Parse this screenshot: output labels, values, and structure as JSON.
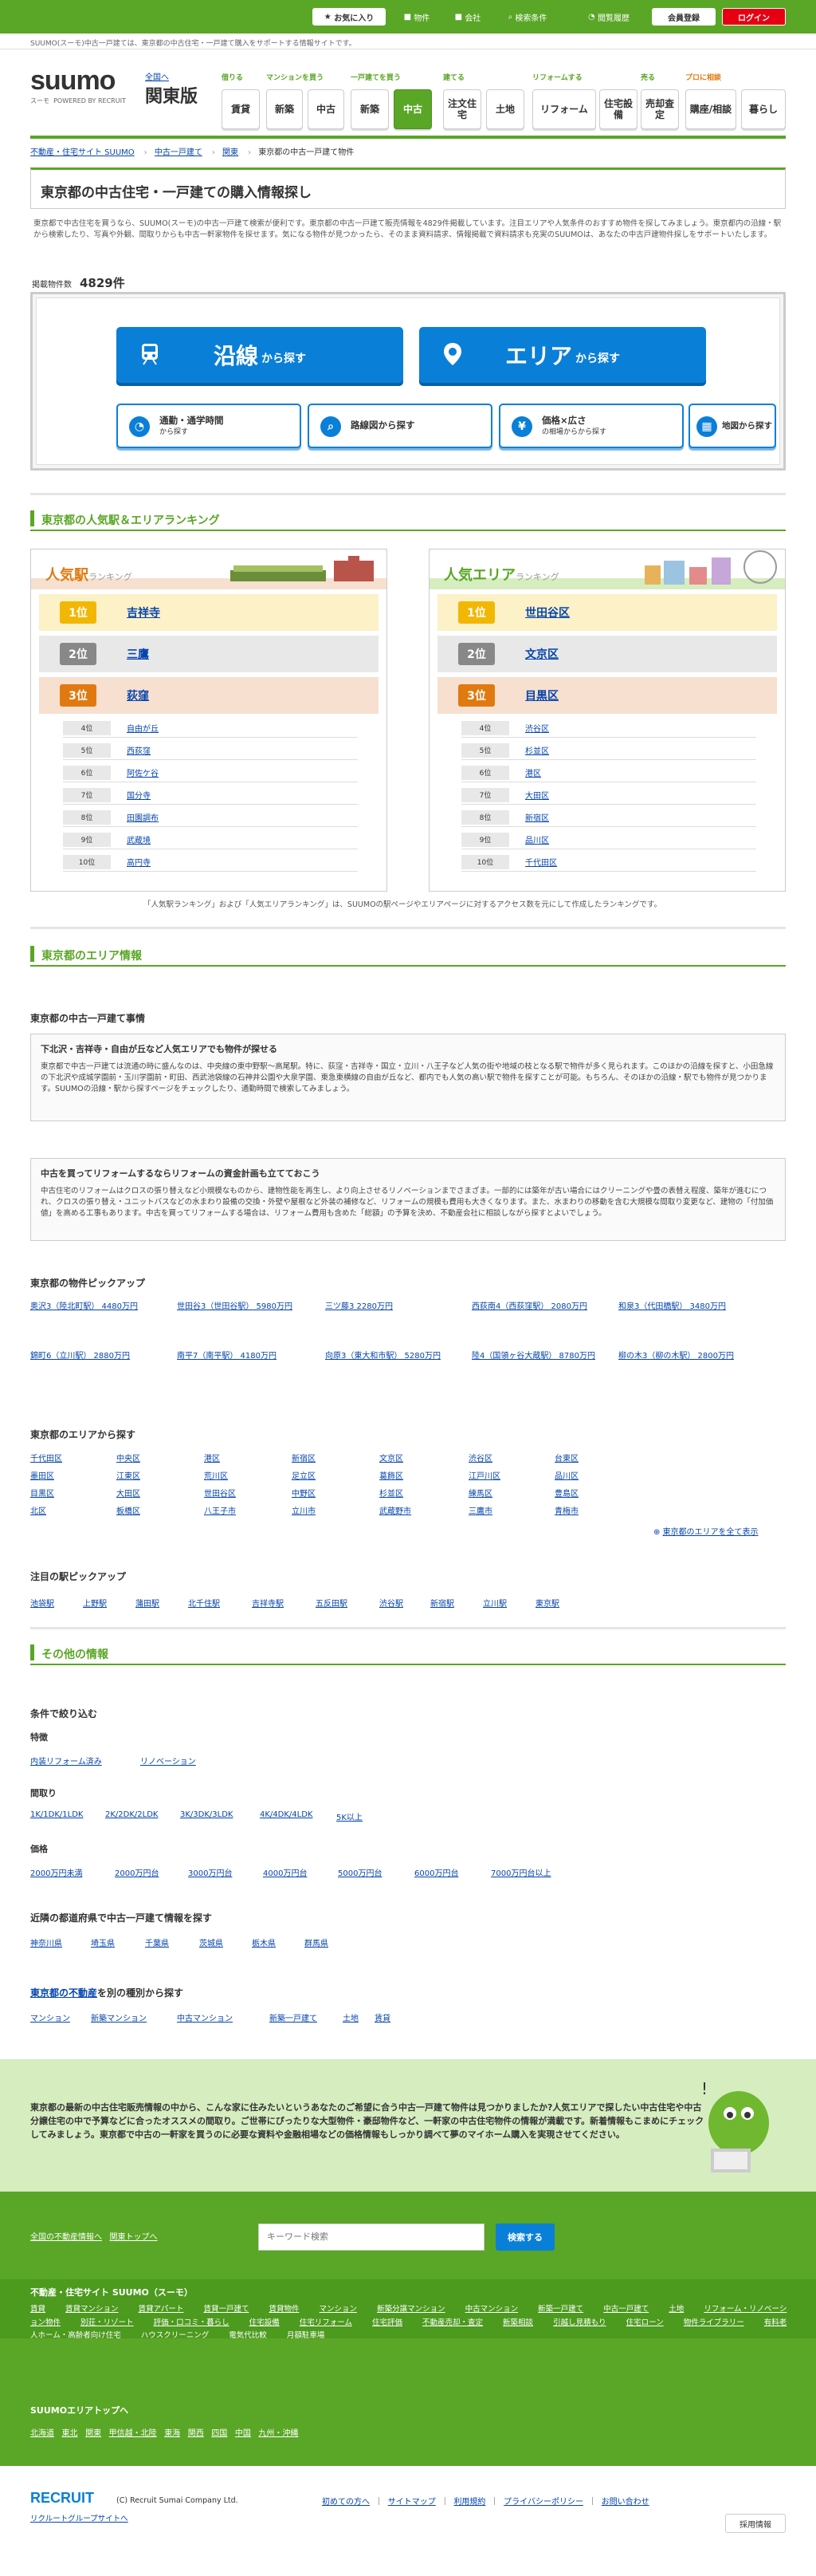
{
  "topbar": {
    "favorites": "お気に入り",
    "property": "物件",
    "company": "会社",
    "articles": "検索条件",
    "history": "閲覧履歴",
    "register": "会員登録",
    "login": "ログイン"
  },
  "header": {
    "tagline": "SUUMO(スーモ)中古一戸建ては、東京都の中古住宅・一戸建て購入をサポートする情報サイトです。",
    "logo": "suumo",
    "logo_sub": "スーモ",
    "logo_powered": "POWERED BY RECRUIT",
    "all_regions": "全国へ",
    "region": "関東版"
  },
  "nav": {
    "groups": [
      "借りる",
      "マンションを買う",
      "一戸建てを買う",
      "建てる",
      "リフォームする",
      "売る",
      "プロに相談"
    ],
    "buttons": [
      "賃貸",
      "新築",
      "中古",
      "新築",
      "中古",
      "注文住宅",
      "土地",
      "リフォーム",
      "住宅設備",
      "売却査定",
      "購座/相談",
      "暮らし"
    ]
  },
  "breadcrumb": [
    "不動産・住宅サイト SUUMO",
    "中古一戸建て",
    "関東",
    "東京都の中古一戸建て物件"
  ],
  "page_title": "東京都の中古住宅・一戸建ての購入情報探し",
  "intro": "東京都で中古住宅を買うなら、SUUMO(スーモ)の中古一戸建て検索が便利です。東京都の中古一戸建て販売情報を4829件掲載しています。注目エリアや人気条件のおすすめ物件を探してみましょう。東京都内の沿線・駅から検索したり、写真や外観、間取りからも中古一軒家物件を探せます。気になる物件が見つかったら、そのまま資料請求、情報掲載で資料請求も充実のSUUMOは、あなたの中古戸建物件探しをサポートいたします。",
  "count": {
    "label": "掲載物件数",
    "value": "4829件"
  },
  "search": {
    "line": {
      "big": "沿線",
      "small": "から探す"
    },
    "area": {
      "big": "エリア",
      "small": "から探す"
    },
    "commute": {
      "label": "通勤・通学時間",
      "sub": "から探す"
    },
    "route": {
      "label": "路線図から探す"
    },
    "price": {
      "label": "価格×広さ",
      "sub": "の相場からから探す"
    },
    "map": {
      "label": "地図から探す"
    }
  },
  "ranking": {
    "header": "東京都の人気駅＆エリアランキング",
    "station": {
      "title": "人気駅",
      "title_sub": "ランキング",
      "top": [
        "吉祥寺",
        "三鷹",
        "荻窪"
      ],
      "rest": [
        {
          "rank": "4位",
          "name": "自由が丘"
        },
        {
          "rank": "5位",
          "name": "西荻窪"
        },
        {
          "rank": "6位",
          "name": "阿佐ケ谷"
        },
        {
          "rank": "7位",
          "name": "国分寺"
        },
        {
          "rank": "8位",
          "name": "田園調布"
        },
        {
          "rank": "9位",
          "name": "武蔵境"
        },
        {
          "rank": "10位",
          "name": "高円寺"
        }
      ]
    },
    "area": {
      "title": "人気エリア",
      "title_sub": "ランキング",
      "top": [
        "世田谷区",
        "文京区",
        "目黒区"
      ],
      "rest": [
        {
          "rank": "4位",
          "name": "渋谷区"
        },
        {
          "rank": "5位",
          "name": "杉並区"
        },
        {
          "rank": "6位",
          "name": "港区"
        },
        {
          "rank": "7位",
          "name": "大田区"
        },
        {
          "rank": "8位",
          "name": "新宿区"
        },
        {
          "rank": "9位",
          "name": "品川区"
        },
        {
          "rank": "10位",
          "name": "千代田区"
        }
      ]
    },
    "medals": [
      "1位",
      "2位",
      "3位"
    ],
    "note": "「人気駅ランキング」および「人気エリアランキング」は、SUUMOの駅ページやエリアページに対するアクセス数を元にして作成したランキングです。"
  },
  "areainfo": {
    "header": "東京都のエリア情報",
    "subtitle": "東京都の中古一戸建て事情",
    "box1_title": "下北沢・吉祥寺・自由が丘など人気エリアでも物件が探せる",
    "box1_text": "東京都で中古一戸建ては流通の時に盛んなのは、中央線の東中野駅〜高尾駅。特に、荻窪・吉祥寺・国立・立川・八王子など人気の街や地域の枝となる駅で物件が多く見られます。このほかの沿線を探すと、小田急線の下北沢や成城学園前・玉川学園前・町田、西武池袋線の石神井公園や大泉学園、東急東横線の自由が丘など、都内でも人気の高い駅で物件を探すことが可能。もちろん、そのほかの沿線・駅でも物件が見つかります。SUUMOの沿線・駅から探すページをチェックしたり、通勤時間で検索してみましょう。",
    "box2_title": "中古を買ってリフォームするならリフォームの資金計画も立てておこう",
    "box2_text": "中古住宅のリフォームはクロスの張り替えなど小規模なものから、建物性能を再生し、より向上させるリノベーションまでさまざま。一部的には築年が古い場合にはクリーニングや畳の表替え程度、築年が進むにつれ、クロスの張り替え・ユニットバスなどの水まわり設備の交換・外壁や屋根など外装の補修など、リフォームの規模も費用も大きくなります。また、水まわりの移動を含む大規模な間取り変更など、建物の「付加価値」を高める工事もあります。中古を買ってリフォームする場合は、リフォーム費用も含めた「総額」の予算を決め、不動産会社に相談しながら探すとよいでしょう。"
  },
  "picks": {
    "title": "東京都の物件ピックアップ",
    "items": [
      "奥沢3（陸北町駅） 4480万円",
      "世田谷3（世田谷駅） 5980万円",
      "三ツ藤3 2280万円",
      "西荻南4（西荻窪駅） 2080万円",
      "和泉3（代田橋駅） 3480万円",
      "錦町6（立川駅） 2880万円",
      "南平7（南平駅） 4180万円",
      "向原3（東大和市駅） 5280万円",
      "陸4（国領ヶ谷大蔵駅） 8780万円",
      "柳の木3（柳の木駅） 2800万円"
    ]
  },
  "areas": {
    "title": "東京都のエリアから探す",
    "items": [
      "千代田区",
      "中央区",
      "港区",
      "新宿区",
      "文京区",
      "渋谷区",
      "台東区",
      "墨田区",
      "江東区",
      "荒川区",
      "足立区",
      "葛飾区",
      "江戸川区",
      "品川区",
      "目黒区",
      "大田区",
      "世田谷区",
      "中野区",
      "杉並区",
      "練馬区",
      "豊島区",
      "北区",
      "板橋区",
      "八王子市",
      "立川市",
      "武蔵野市",
      "三鷹市",
      "青梅市"
    ],
    "more": "東京都のエリアを全て表示"
  },
  "stations": {
    "title": "注目の駅ピックアップ",
    "items": [
      "池袋駅",
      "上野駅",
      "蒲田駅",
      "北千住駅",
      "吉祥寺駅",
      "五反田駅",
      "渋谷駅",
      "新宿駅",
      "立川駅",
      "東京駅"
    ]
  },
  "other": {
    "header": "その他の情報",
    "narrow": "条件で絞り込む",
    "feature": "特徴",
    "feature_items": [
      "内装リフォーム済み",
      "リノベーション"
    ],
    "layout": "間取り",
    "layout_items": [
      "1K/1DK/1LDK",
      "2K/2DK/2LDK",
      "3K/3DK/3LDK",
      "4K/4DK/4LDK",
      "5K以上"
    ],
    "price": "価格",
    "price_items": [
      "2000万円未満",
      "2000万円台",
      "3000万円台",
      "4000万円台",
      "5000万円台",
      "6000万円台",
      "7000万円台以上"
    ],
    "nearby": "近隣の都道府県で中古一戸建て情報を探す",
    "nearby_items": [
      "神奈川県",
      "埼玉県",
      "千葉県",
      "茨城県",
      "栃木県",
      "群馬県"
    ],
    "types_title": "東京都の不動産",
    "types_suffix": "を別の種別から探す",
    "types_items": [
      "マンション",
      "新築マンション",
      "中古マンション",
      "新築一戸建て",
      "土地",
      "賃貸"
    ]
  },
  "banner": "東京都の最新の中古住宅販売情報の中から、こんな家に住みたいというあなたのご希望に合う中古一戸建て物件は見つかりましたか?人気エリアで探したい中古住宅や中古分譲住宅の中で予算などに合ったオススメの間取り。ご世帯にぴったりな大型物件・豪邸物件など、一軒家の中古住宅物件の情報が満載です。新着情報もこまめにチェックしてみましょう。東京都で中古の一軒家を買うのに必要な資料や金融相場などの価格情報もしっかり調べて夢のマイホーム購入を実現させてください。",
  "footer": {
    "links1": [
      "全国の不動産情報へ",
      "関東トップへ"
    ],
    "search_placeholder": "キーワード検索",
    "search_button": "検索する",
    "site_title": "不動産・住宅サイト SUUMO（スーモ）",
    "site_links": [
      "賃貸",
      "賃貸マンション",
      "賃貸アパート",
      "賃貸一戸建て",
      "賃貸物件",
      "マンション",
      "新築分譲マンション",
      "中古マンション",
      "新築一戸建て",
      "中古一戸建て",
      "土地",
      "リフォーム・リノベーション物件",
      "別荘・リゾート",
      "評価・口コミ・暮らし",
      "住宅設備",
      "住宅リフォーム",
      "住宅評価",
      "不動産売却・査定",
      "新築相談",
      "引越し見積もり",
      "住宅ローン",
      "物件ライブラリー",
      "有料老人ホーム・高齢者向け住宅",
      "ハウスクリーニング",
      "電気代比較",
      "月額駐車場"
    ],
    "region_title": "SUUMOエリアトップへ",
    "regions": [
      "北海道",
      "東北",
      "関東",
      "甲信越・北陸",
      "東海",
      "関西",
      "四国",
      "中国",
      "九州・沖縄"
    ],
    "company": "(C) Recruit Sumai Company Ltd.",
    "group": "リクルートグループサイトへ",
    "bottom_links": [
      "初めての方へ",
      "サイトマップ",
      "利用規約",
      "プライバシーポリシー",
      "お問い合わせ"
    ],
    "recruit": "RECRUIT",
    "jobs": "採用情報"
  },
  "colors": {
    "brand_green": "#5aa626",
    "search_blue": "#0a7fd8",
    "gold": "#f2b705",
    "silver": "#888888",
    "bronze": "#e07a10"
  }
}
